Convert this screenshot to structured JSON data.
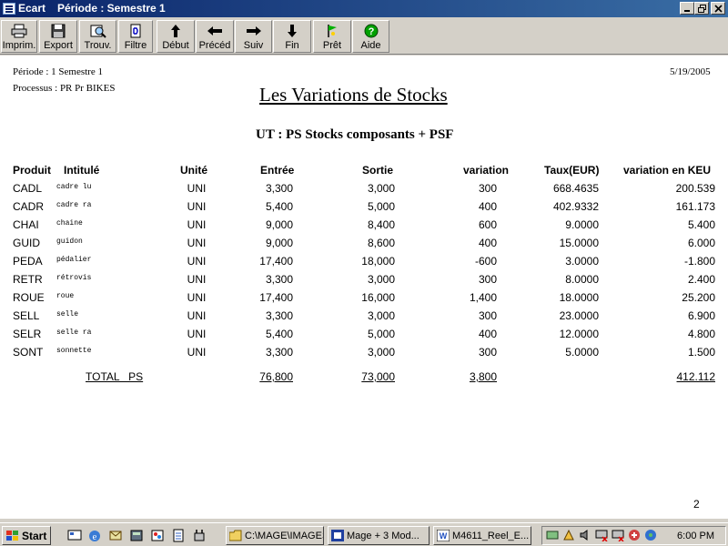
{
  "window": {
    "app_name": "Ecart",
    "title": "Période : Semestre 1"
  },
  "toolbar": {
    "buttons": [
      {
        "label": "Imprim.",
        "icon": "printer-icon"
      },
      {
        "label": "Export",
        "icon": "floppy-disk-icon"
      },
      {
        "label": "Trouv.",
        "icon": "find-icon"
      },
      {
        "label": "Filtre",
        "icon": "filter-icon"
      },
      {
        "label": "Début",
        "icon": "arrow-up-icon"
      },
      {
        "label": "Précéd",
        "icon": "arrow-left-icon"
      },
      {
        "label": "Suiv",
        "icon": "arrow-right-icon"
      },
      {
        "label": "Fin",
        "icon": "arrow-down-icon"
      },
      {
        "label": "Prêt",
        "icon": "flag-icon"
      },
      {
        "label": "Aide",
        "icon": "help-icon"
      }
    ]
  },
  "report": {
    "periode": "Période : 1  Semestre 1",
    "processus": "Processus :  PR  Pr BIKES",
    "date": "5/19/2005",
    "title": "Les Variations de Stocks",
    "subtitle": "UT :  PS  Stocks composants + PSF",
    "columns": {
      "produit": "Produit",
      "intitule": "Intitulé",
      "unite": "Unité",
      "entree": "Entrée",
      "sortie": "Sortie",
      "variation": "variation",
      "taux": "Taux(EUR)",
      "variation_keu": "variation en KEU"
    },
    "rows": [
      {
        "produit": "CADL",
        "intitule": "cadre lu",
        "unite": "UNI",
        "entree": "3,300",
        "sortie": "3,000",
        "variation": "300",
        "taux": "668.4635",
        "keu": "200.539"
      },
      {
        "produit": "CADR",
        "intitule": "cadre ra",
        "unite": "UNI",
        "entree": "5,400",
        "sortie": "5,000",
        "variation": "400",
        "taux": "402.9332",
        "keu": "161.173"
      },
      {
        "produit": "CHAI",
        "intitule": "chaine",
        "unite": "UNI",
        "entree": "9,000",
        "sortie": "8,400",
        "variation": "600",
        "taux": "9.0000",
        "keu": "5.400"
      },
      {
        "produit": "GUID",
        "intitule": "guidon",
        "unite": "UNI",
        "entree": "9,000",
        "sortie": "8,600",
        "variation": "400",
        "taux": "15.0000",
        "keu": "6.000"
      },
      {
        "produit": "PEDA",
        "intitule": "pédalier",
        "unite": "UNI",
        "entree": "17,400",
        "sortie": "18,000",
        "variation": "-600",
        "taux": "3.0000",
        "keu": "-1.800"
      },
      {
        "produit": "RETR",
        "intitule": "rétrovis",
        "unite": "UNI",
        "entree": "3,300",
        "sortie": "3,000",
        "variation": "300",
        "taux": "8.0000",
        "keu": "2.400"
      },
      {
        "produit": "ROUE",
        "intitule": "roue",
        "unite": "UNI",
        "entree": "17,400",
        "sortie": "16,000",
        "variation": "1,400",
        "taux": "18.0000",
        "keu": "25.200"
      },
      {
        "produit": "SELL",
        "intitule": "selle",
        "unite": "UNI",
        "entree": "3,300",
        "sortie": "3,000",
        "variation": "300",
        "taux": "23.0000",
        "keu": "6.900"
      },
      {
        "produit": "SELR",
        "intitule": "selle ra",
        "unite": "UNI",
        "entree": "5,400",
        "sortie": "5,000",
        "variation": "400",
        "taux": "12.0000",
        "keu": "4.800"
      },
      {
        "produit": "SONT",
        "intitule": "sonnette",
        "unite": "UNI",
        "entree": "3,300",
        "sortie": "3,000",
        "variation": "300",
        "taux": "5.0000",
        "keu": "1.500"
      }
    ],
    "total": {
      "label": "TOTAL   PS",
      "entree": "76,800",
      "sortie": "73,000",
      "variation": "3,800",
      "keu": "412.112"
    },
    "page_number": "2"
  },
  "taskbar": {
    "start_label": "Start",
    "tasks": [
      {
        "label": "C:\\MAGE\\IMAGES",
        "icon": "folder-icon"
      },
      {
        "label": "Mage + 3    Mod...",
        "icon": "app-icon"
      },
      {
        "label": "M4611_Reel_E...",
        "icon": "document-icon"
      }
    ],
    "clock": "6:00 PM"
  }
}
